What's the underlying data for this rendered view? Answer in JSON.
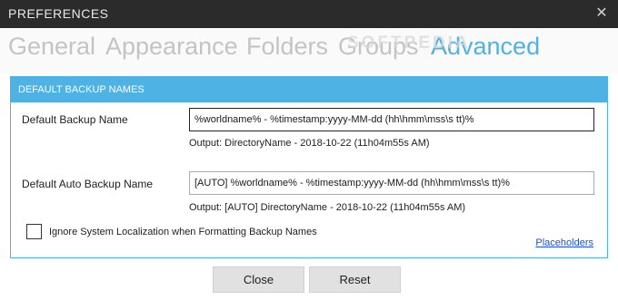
{
  "window": {
    "title": "PREFERENCES",
    "close_glyph": "✕"
  },
  "tabs": [
    {
      "label": "General"
    },
    {
      "label": "Appearance"
    },
    {
      "label": "Folders"
    },
    {
      "label": "Groups"
    },
    {
      "label": "Advanced",
      "active": true
    }
  ],
  "watermark": "SOFTPEDIA",
  "panel": {
    "header": "DEFAULT BACKUP NAMES",
    "backup_name": {
      "label": "Default Backup Name",
      "value": "%worldname% - %timestamp:yyyy-MM-dd (hh\\hmm\\mss\\s tt)%",
      "output": "Output: DirectoryName - 2018-10-22 (11h04m55s AM)"
    },
    "auto_backup_name": {
      "label": "Default Auto Backup Name",
      "value": "[AUTO] %worldname% - %timestamp:yyyy-MM-dd (hh\\hmm\\mss\\s tt)%",
      "output": "Output: [AUTO] DirectoryName - 2018-10-22 (11h04m55s AM)"
    },
    "ignore_localization": {
      "label": "Ignore System Localization when Formatting Backup Names",
      "checked": false
    },
    "placeholders_link": "Placeholders"
  },
  "buttons": {
    "close": "Close",
    "reset": "Reset"
  },
  "colors": {
    "accent": "#4fb2e4",
    "titlebar": "#2b2b2b",
    "link": "#1a4fd9"
  }
}
